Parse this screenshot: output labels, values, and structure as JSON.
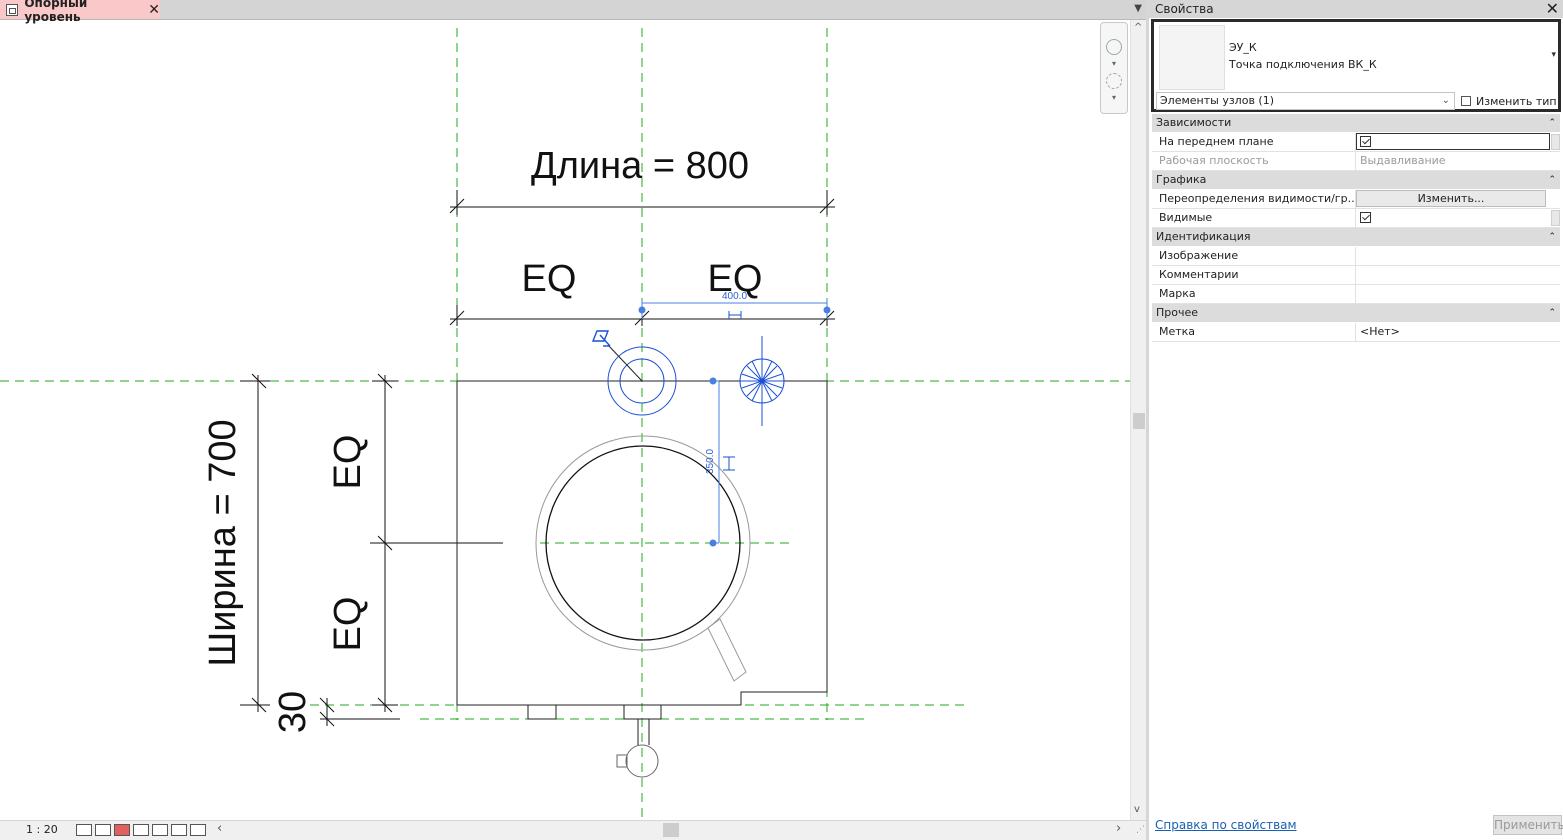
{
  "view": {
    "tab_label": "Опорный уровень",
    "tab_close": "✕",
    "tab_menu": "▼",
    "scale": "1 : 20",
    "scroll_left": "‹",
    "scroll_right": "›",
    "scroll_up": "^",
    "scroll_down": "v"
  },
  "drawing": {
    "length_label": "Длина = 800",
    "width_label": "Ширина = 700",
    "eq_top_left": "EQ",
    "eq_top_right": "EQ",
    "eq_side_top": "EQ",
    "eq_side_bottom": "EQ",
    "offset_label": "30",
    "temp_dim_horizontal": "400.0",
    "temp_dim_vertical": "350.0"
  },
  "properties": {
    "title": "Свойства",
    "close": "✕",
    "type_family": "ЭУ_К",
    "type_name": "Точка подключения ВК_К",
    "type_dropdown": "▾",
    "element_filter": "Элементы узлов (1)",
    "element_filter_chevron": "⌄",
    "edit_type_label": "Изменить тип",
    "groups": {
      "constraints": {
        "label": "Зависимости",
        "collapse": "⌃",
        "rows": {
          "foreground": {
            "name": "На переднем плане",
            "checked": true
          },
          "workplane": {
            "name": "Рабочая плоскость",
            "value": "Выдавливание"
          }
        }
      },
      "graphics": {
        "label": "Графика",
        "collapse": "⌃",
        "rows": {
          "overrides": {
            "name": "Переопределения видимости/гр...",
            "button": "Изменить..."
          },
          "visible": {
            "name": "Видимые",
            "checked": true
          }
        }
      },
      "identity": {
        "label": "Идентификация",
        "collapse": "⌃",
        "rows": {
          "image": {
            "name": "Изображение",
            "value": ""
          },
          "comments": {
            "name": "Комментарии",
            "value": ""
          },
          "mark": {
            "name": "Марка",
            "value": ""
          }
        }
      },
      "other": {
        "label": "Прочее",
        "collapse": "⌃",
        "rows": {
          "label": {
            "name": "Метка",
            "value": "<Нет>"
          }
        }
      }
    },
    "help_link": "Справка по свойствам",
    "apply_label": "Применить"
  },
  "colors": {
    "tab_active": "#fac8c8",
    "reference_plane": "#22aa22",
    "selection": "#1a4fd6",
    "temp_dimension": "#4a7fe0"
  }
}
